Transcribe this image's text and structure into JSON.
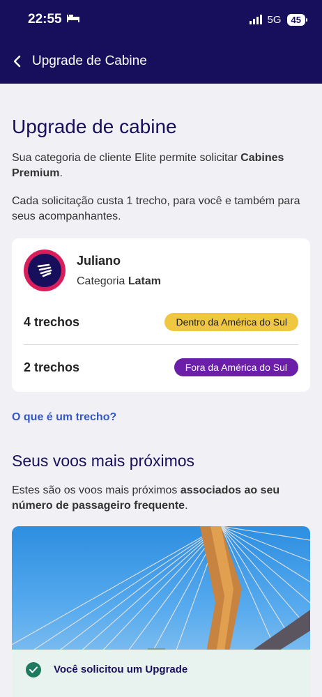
{
  "status_bar": {
    "time": "22:55",
    "network": "5G",
    "battery": "45"
  },
  "header": {
    "title": "Upgrade de Cabine"
  },
  "main": {
    "heading": "Upgrade de cabine",
    "intro_before": "Sua categoria de cliente Elite permite solicitar ",
    "intro_bold": "Cabines Premium",
    "intro_after": ".",
    "cost_text": "Cada solicitação custa 1 trecho, para você e também para seus acompanhantes.",
    "card": {
      "name": "Juliano",
      "category_label": "Categoria ",
      "category_value": "Latam",
      "rows": [
        {
          "label": "4 trechos",
          "badge": "Dentro da América do Sul"
        },
        {
          "label": "2 trechos",
          "badge": "Fora da América do Sul"
        }
      ]
    },
    "link": "O que é um trecho?",
    "flights_heading": "Seus voos mais próximos",
    "flights_text_before": "Estes são os voos mais próximos ",
    "flights_text_bold": "associados ao seu número de passageiro frequente",
    "flights_text_after": ".",
    "notice": "Você solicitou um Upgrade"
  },
  "colors": {
    "header": "#180f5c",
    "yellow_badge": "#f0c741",
    "purple_badge": "#6b1ea8",
    "link": "#3557c9",
    "success": "#1d7a5f"
  }
}
